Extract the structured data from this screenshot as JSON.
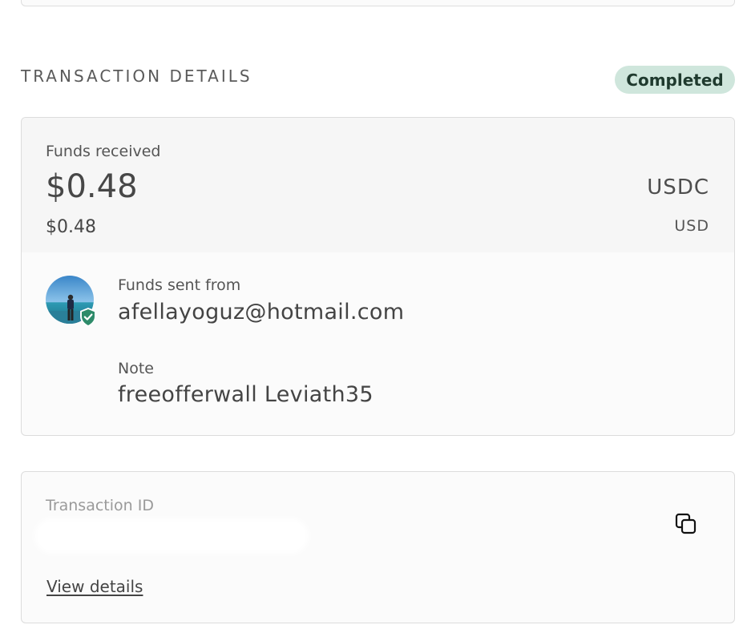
{
  "section": {
    "title": "TRANSACTION DETAILS",
    "status": "Completed"
  },
  "details": {
    "funds_label": "Funds received",
    "amount": "$0.48",
    "currency": "USDC",
    "amount_converted": "$0.48",
    "currency_converted": "USD",
    "sender_label": "Funds sent from",
    "sender": "afellayoguz@hotmail.com",
    "note_label": "Note",
    "note": "freeofferwall Leviath35"
  },
  "transaction": {
    "id_label": "Transaction ID",
    "view_details": "View details"
  },
  "icons": {
    "verified": "shield-check-icon",
    "copy": "copy-icon"
  },
  "colors": {
    "badge_bg": "#cfe6dc",
    "badge_text": "#1f3a2e",
    "verified_shield": "#2e8b6a"
  }
}
